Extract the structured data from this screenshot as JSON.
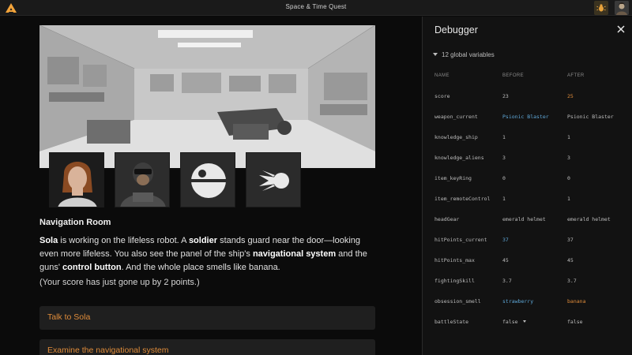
{
  "app": {
    "title": "Space & Time Quest"
  },
  "topbar": {
    "bug_icon": "bug-icon",
    "avatar_icon": "user-avatar-icon",
    "logo_icon": "app-logo-icon"
  },
  "game": {
    "room_title": "Navigation Room",
    "story": {
      "p1": "Sola",
      "p2": " is working on the lifeless robot. A ",
      "p3": "soldier",
      "p4": " stands guard near the door—looking even more lifeless. You also see the panel of the ship's ",
      "p5": "navigational system",
      "p6": " and the guns' ",
      "p7": "control button",
      "p8": ". And the whole place smells like banana."
    },
    "score_note": "(Your score has just gone up by 2 points.)",
    "choices": [
      "Talk to Sola",
      "Examine the navigational system"
    ],
    "portraits": [
      "sola-portrait",
      "soldier-portrait",
      "space-station-icon",
      "comet-icon"
    ]
  },
  "debugger": {
    "title": "Debugger",
    "globals_label": "12 global variables",
    "columns": {
      "name": "NAME",
      "before": "BEFORE",
      "after": "AFTER"
    },
    "colors": {
      "changed": "#5fa8d9",
      "new_value": "#e08c3a"
    },
    "variables": [
      {
        "name": "score",
        "before": "23",
        "after": "25"
      },
      {
        "name": "weapon_current",
        "before": "Psionic Blaster",
        "after": "Psionic Blaster"
      },
      {
        "name": "knowledge_ship",
        "before": "1",
        "after": "1"
      },
      {
        "name": "knowledge_aliens",
        "before": "3",
        "after": "3"
      },
      {
        "name": "item_keyRing",
        "before": "0",
        "after": "0"
      },
      {
        "name": "item_remoteControl",
        "before": "1",
        "after": "1"
      },
      {
        "name": "headGear",
        "before": "emerald helmet",
        "after": "emerald helmet"
      },
      {
        "name": "hitPoints_current",
        "before": "37",
        "after": "37"
      },
      {
        "name": "hitPoints_max",
        "before": "45",
        "after": "45"
      },
      {
        "name": "fightingSkill",
        "before": "3.7",
        "after": "3.7"
      },
      {
        "name": "obsession_smell",
        "before": "strawberry",
        "after": "banana"
      },
      {
        "name": "battleState",
        "before": "false",
        "after": "false"
      }
    ]
  }
}
